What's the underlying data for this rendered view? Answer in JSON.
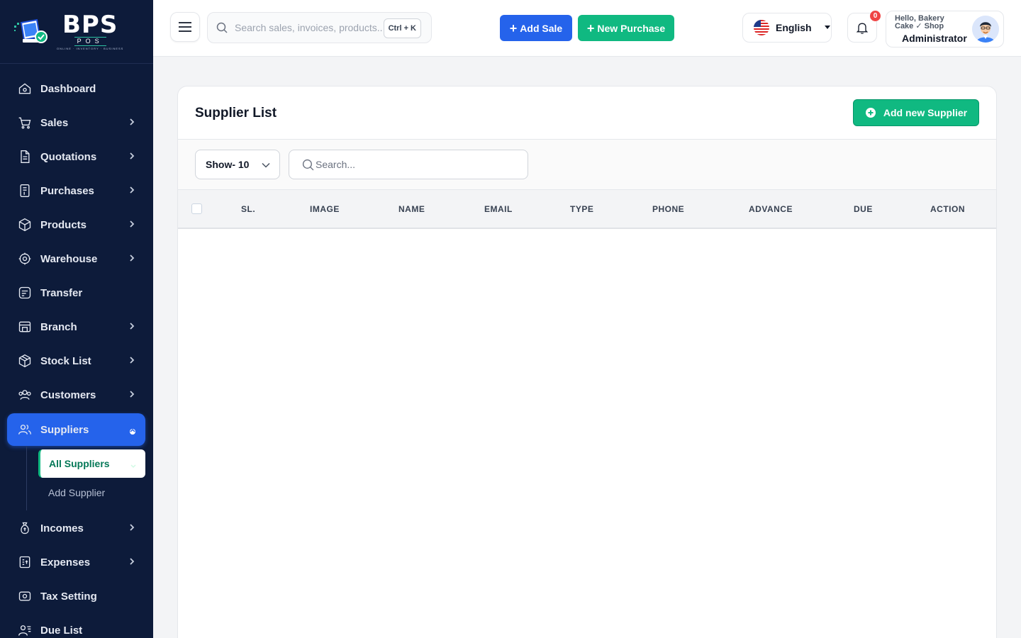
{
  "brand": {
    "name": "BPS",
    "sub": "POS",
    "tagline": "ONLINE · INVENTORY · BUSINESS"
  },
  "sidebar": {
    "items": [
      {
        "label": "Dashboard",
        "icon": "home-icon"
      },
      {
        "label": "Sales",
        "icon": "cart-icon"
      },
      {
        "label": "Quotations",
        "icon": "document-icon"
      },
      {
        "label": "Purchases",
        "icon": "receipt-icon"
      },
      {
        "label": "Products",
        "icon": "box-icon"
      },
      {
        "label": "Warehouse",
        "icon": "warehouse-icon"
      },
      {
        "label": "Transfer",
        "icon": "transfer-icon"
      },
      {
        "label": "Branch",
        "icon": "store-icon"
      },
      {
        "label": "Stock List",
        "icon": "package-icon"
      },
      {
        "label": "Customers",
        "icon": "users-icon"
      },
      {
        "label": "Suppliers",
        "icon": "user-group-icon"
      },
      {
        "label": "Incomes",
        "icon": "money-bag-icon"
      },
      {
        "label": "Expenses",
        "icon": "bill-icon"
      },
      {
        "label": "Tax Setting",
        "icon": "tax-icon"
      },
      {
        "label": "Due List",
        "icon": "user-list-icon"
      }
    ],
    "sub_items": [
      {
        "label": "All Suppliers"
      },
      {
        "label": "Add Supplier"
      }
    ]
  },
  "topbar": {
    "search_placeholder": "Search sales, invoices, products...",
    "shortcut": "Ctrl + K",
    "add_sale": "Add Sale",
    "new_purchase": "New Purchase",
    "language": "English",
    "notifications": "0",
    "greeting": "Hello, Bakery Cake ✓ Shop",
    "role": "Administrator"
  },
  "main": {
    "title": "Supplier List",
    "add_button": "Add new Supplier",
    "show_label": "Show- 10",
    "search_placeholder": "Search...",
    "columns": [
      "SL.",
      "IMAGE",
      "NAME",
      "EMAIL",
      "TYPE",
      "PHONE",
      "ADVANCE",
      "DUE",
      "ACTION"
    ]
  },
  "colors": {
    "sidebar": "#0d1b3a",
    "primary": "#2563eb",
    "success": "#10b981",
    "danger": "#ef4444"
  }
}
